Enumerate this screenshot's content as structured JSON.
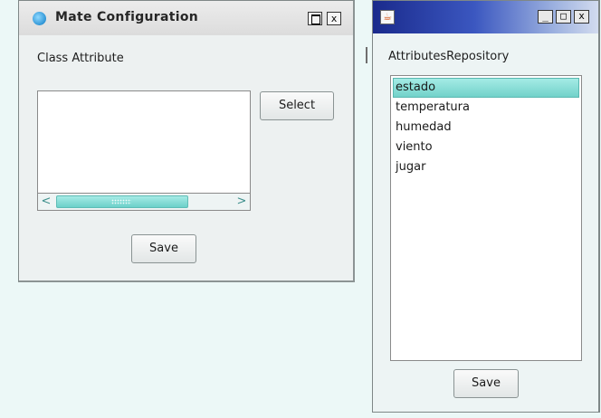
{
  "mate_window": {
    "title": "Mate Configuration",
    "max_button": "",
    "close_button": "x",
    "class_attribute_label": "Class Attribute",
    "select_button": "Select",
    "save_button": "Save",
    "scroll_left": "<",
    "scroll_right": ">",
    "class_attribute_items": []
  },
  "repository_window": {
    "title": "",
    "min_button": "_",
    "max_button": "□",
    "close_button": "x",
    "repository_label": "AttributesRepository",
    "items": [
      {
        "label": "estado",
        "selected": true
      },
      {
        "label": "temperatura",
        "selected": false
      },
      {
        "label": "humedad",
        "selected": false
      },
      {
        "label": "viento",
        "selected": false
      },
      {
        "label": "jugar",
        "selected": false
      }
    ],
    "save_button": "Save"
  },
  "colors": {
    "desktop": "#ecf8f7",
    "selection": "#72d2ca",
    "titlebar_active": "#1a2a8c"
  }
}
